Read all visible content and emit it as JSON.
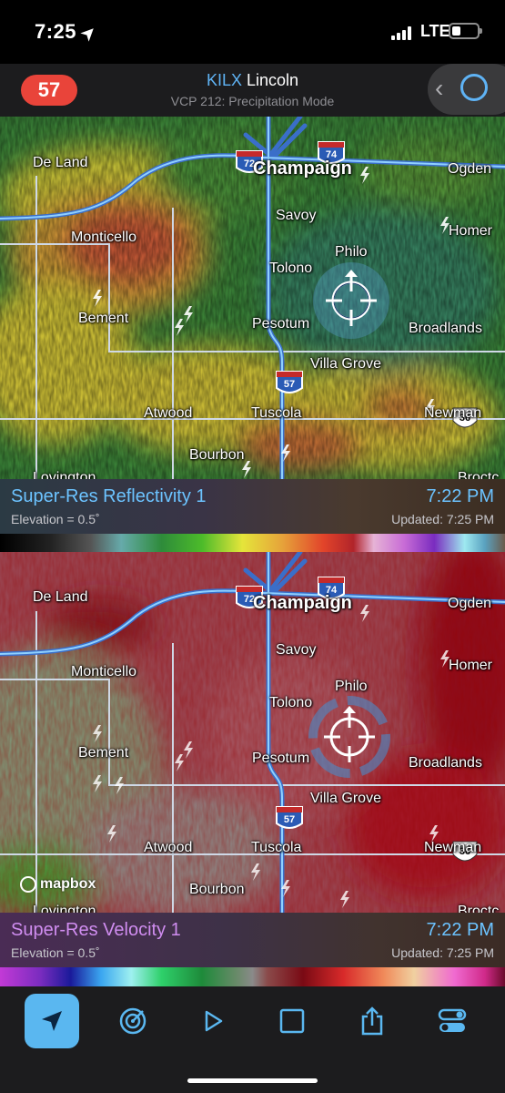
{
  "status_bar": {
    "time": "7:25",
    "network": "LTE"
  },
  "header": {
    "badge_count": "57",
    "station_code": "KILX",
    "station_name": "Lincoln",
    "mode": "VCP 212: Precipitation Mode"
  },
  "map_labels": {
    "de_land": "De Land",
    "champaign": "Champaign",
    "ogden": "Ogden",
    "savoy": "Savoy",
    "homer": "Homer",
    "monticello": "Monticello",
    "philo": "Philo",
    "tolono": "Tolono",
    "bement": "Bement",
    "pesotum": "Pesotum",
    "broadlands": "Broadlands",
    "villa_grove": "Villa Grove",
    "atwood": "Atwood",
    "tuscola": "Tuscola",
    "newman": "Newman",
    "bourbon": "Bourbon",
    "lovington": "Lovington",
    "brocton": "Broctc"
  },
  "shields": {
    "i72": "72",
    "i74": "74",
    "i57": "57",
    "us36": "36"
  },
  "panels": {
    "reflectivity": {
      "title": "Super-Res Reflectivity 1",
      "time": "7:22 PM",
      "elevation": "Elevation = 0.5˚",
      "updated": "Updated: 7:25 PM"
    },
    "velocity": {
      "title": "Super-Res Velocity 1",
      "time": "7:22 PM",
      "elevation": "Elevation = 0.5˚",
      "updated": "Updated: 7:25 PM"
    }
  },
  "attribution": "mapbox",
  "colors": {
    "accent": "#5ab7f0",
    "badge": "#e9443a",
    "title_blue": "#6cc3ff"
  },
  "tab_bar": [
    "location-arrow-icon",
    "radar-sweep-icon",
    "play-icon",
    "square-icon",
    "share-icon",
    "toggles-icon"
  ]
}
